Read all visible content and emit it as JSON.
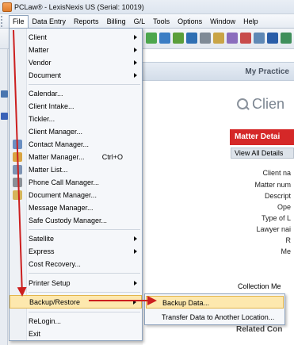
{
  "window": {
    "title": "PCLaw® - LexisNexis US (Serial: 10019)"
  },
  "menubar": [
    "File",
    "Data Entry",
    "Reports",
    "Billing",
    "G/L",
    "Tools",
    "Options",
    "Window",
    "Help"
  ],
  "panel": {
    "header_title": "My Practice",
    "search_text": "Clien",
    "matter_details_title": "Matter Detai",
    "view_all_tab": "View All Details",
    "detail_labels": [
      "Client na",
      "Matter num",
      "Descript",
      "Ope",
      "Type of L",
      "Lawyer nai",
      "R",
      "Me",
      "Collection Me"
    ],
    "related_title": "Related Con"
  },
  "file_menu": {
    "items": [
      {
        "label": "Client",
        "submenu": true
      },
      {
        "label": "Matter",
        "submenu": true
      },
      {
        "label": "Vendor",
        "submenu": true
      },
      {
        "label": "Document",
        "submenu": true
      },
      {
        "label": "Calendar..."
      },
      {
        "label": "Client Intake..."
      },
      {
        "label": "Tickler..."
      },
      {
        "label": "Client Manager..."
      },
      {
        "label": "Contact Manager..."
      },
      {
        "label": "Matter Manager...",
        "shortcut": "Ctrl+O"
      },
      {
        "label": "Matter List..."
      },
      {
        "label": "Phone Call Manager..."
      },
      {
        "label": "Document Manager..."
      },
      {
        "label": "Message Manager..."
      },
      {
        "label": "Safe Custody Manager..."
      },
      {
        "label": "Satellite",
        "submenu": true
      },
      {
        "label": "Express",
        "submenu": true
      },
      {
        "label": "Cost Recovery..."
      },
      {
        "label": "Printer Setup",
        "submenu": true
      },
      {
        "label": "Backup/Restore",
        "submenu": true,
        "highlighted": true
      },
      {
        "label": "ReLogin..."
      },
      {
        "label": "Exit"
      }
    ]
  },
  "backup_submenu": {
    "items": [
      {
        "label": "Backup Data...",
        "highlighted": true
      },
      {
        "label": "Transfer Data to Another Location..."
      }
    ]
  },
  "colors": {
    "highlight": "#fde8ae",
    "matter_header": "#d52828",
    "annotation_arrow": "#cc1f1f"
  }
}
